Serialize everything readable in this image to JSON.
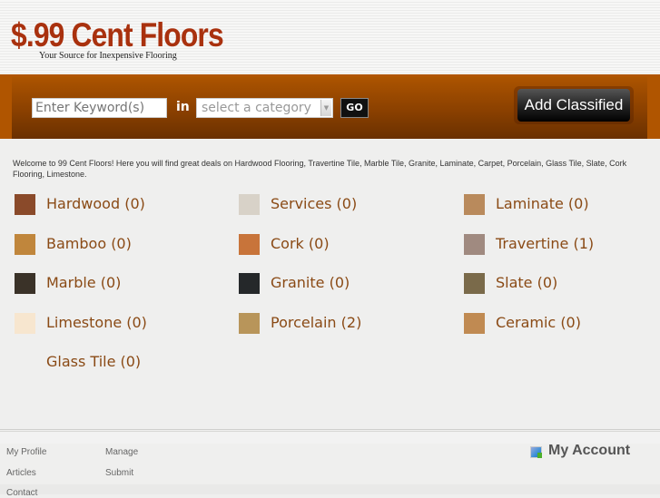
{
  "header": {
    "logo_title": "$.99 Cent Floors",
    "tagline": "Your Source for Inexpensive Flooring"
  },
  "search": {
    "keyword_placeholder": "Enter Keyword(s)",
    "in_label": "in",
    "category_placeholder": "select a category",
    "go_label": "GO",
    "add_classified_label": "Add Classified"
  },
  "welcome_text": "Welcome to 99 Cent Floors! Here you will find great deals on Hardwood Flooring, Travertine Tile, Marble Tile, Granite, Laminate, Carpet, Porcelain, Glass Tile, Slate, Cork Flooring, Limestone.",
  "categories": [
    {
      "label": "Hardwood (0)",
      "thumb": "hardwood-thumb",
      "color": "#8a4a2a"
    },
    {
      "label": "Services (0)",
      "thumb": "services-thumb",
      "color": "#d8d2c8"
    },
    {
      "label": "Laminate (0)",
      "thumb": "laminate-thumb",
      "color": "#b98a5c"
    },
    {
      "label": "Bamboo (0)",
      "thumb": "bamboo-thumb",
      "color": "#c0863c"
    },
    {
      "label": "Cork (0)",
      "thumb": "cork-thumb",
      "color": "#c8743a"
    },
    {
      "label": "Travertine (1)",
      "thumb": "travertine-thumb",
      "color": "#a08a80"
    },
    {
      "label": "Marble (0)",
      "thumb": "marble-thumb",
      "color": "#3a3228"
    },
    {
      "label": "Granite (0)",
      "thumb": "granite-thumb",
      "color": "#25282a"
    },
    {
      "label": "Slate (0)",
      "thumb": "slate-thumb",
      "color": "#7a6a4a"
    },
    {
      "label": "Limestone (0)",
      "thumb": "limestone-thumb",
      "color": "#f7e6cf"
    },
    {
      "label": "Porcelain (2)",
      "thumb": "porcelain-thumb",
      "color": "#b8955a"
    },
    {
      "label": "Ceramic (0)",
      "thumb": "ceramic-thumb",
      "color": "#c08a52"
    },
    {
      "label": "Glass Tile (0)",
      "thumb": "",
      "color": ""
    }
  ],
  "footer": {
    "links": [
      "My Profile",
      "Manage",
      "Articles",
      "Submit",
      "Contact"
    ],
    "my_account_label": "My Account"
  },
  "colors": {
    "brand_red": "#a9310e",
    "bar_orange": "#b05500",
    "link_brown": "#8a4a15"
  }
}
